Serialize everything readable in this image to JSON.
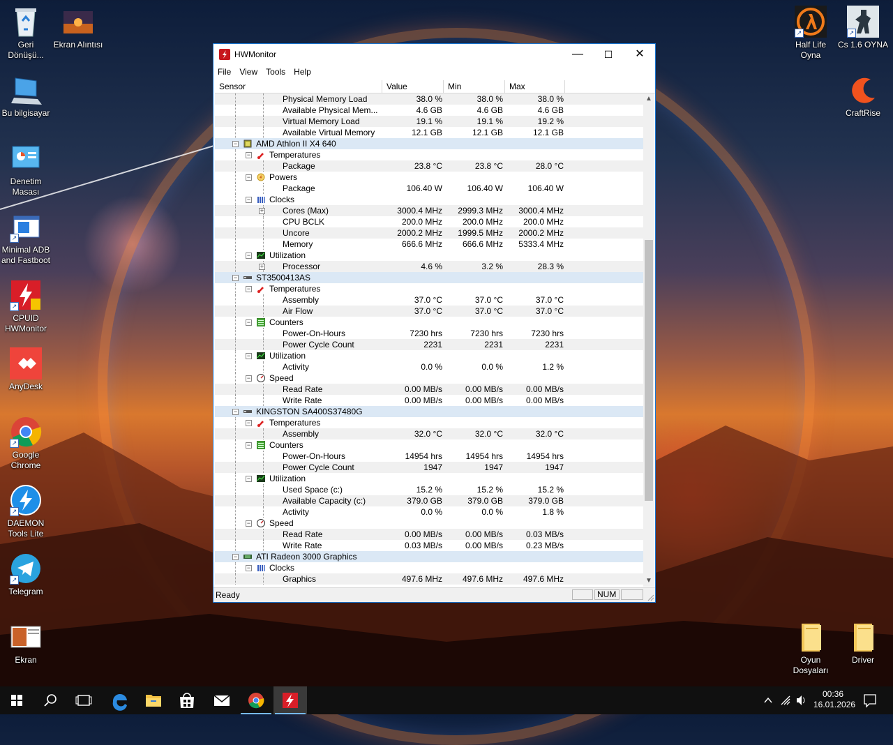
{
  "desktop_icons": [
    {
      "label": "Geri Dönüşü...",
      "icon": "recycle-bin-icon"
    },
    {
      "label": "Ekran Alıntısı",
      "icon": "image-file-icon"
    },
    {
      "label": "Bu bilgisayar",
      "icon": "computer-icon"
    },
    {
      "label": "Denetim Masası",
      "icon": "control-panel-icon"
    },
    {
      "label": "Minimal ADB and Fastboot",
      "icon": "adb-icon"
    },
    {
      "label": "CPUID HWMonitor",
      "icon": "hwmonitor-icon"
    },
    {
      "label": "AnyDesk",
      "icon": "anydesk-icon"
    },
    {
      "label": "Google Chrome",
      "icon": "chrome-icon"
    },
    {
      "label": "DAEMON Tools Lite",
      "icon": "daemon-tools-icon"
    },
    {
      "label": "Telegram",
      "icon": "telegram-icon"
    },
    {
      "label": "Ekran",
      "icon": "image-file-icon"
    },
    {
      "label": "Half Life Oyna",
      "icon": "half-life-icon"
    },
    {
      "label": "Cs 1.6 OYNA",
      "icon": "counter-strike-icon"
    },
    {
      "label": "CraftRise",
      "icon": "craftrise-icon"
    },
    {
      "label": "Oyun Dosyaları",
      "icon": "folder-icon"
    },
    {
      "label": "Driver",
      "icon": "folder-icon"
    }
  ],
  "window": {
    "title": "HWMonitor",
    "minimize": "—",
    "maximize": "☐",
    "close": "✕",
    "menu": [
      "File",
      "View",
      "Tools",
      "Help"
    ],
    "columns": [
      "Sensor",
      "Value",
      "Min",
      "Max"
    ],
    "rows": [
      {
        "label": "Physical Memory Load",
        "value": "38.0 %",
        "min": "38.0 %",
        "max": "38.0 %"
      },
      {
        "label": "Available Physical Mem...",
        "value": "4.6 GB",
        "min": "4.6 GB",
        "max": "4.6 GB"
      },
      {
        "label": "Virtual Memory Load",
        "value": "19.1 %",
        "min": "19.1 %",
        "max": "19.2 %"
      },
      {
        "label": "Available Virtual Memory",
        "value": "12.1 GB",
        "min": "12.1 GB",
        "max": "12.1 GB"
      },
      {
        "label": "AMD Athlon II X4 640"
      },
      {
        "label": "Temperatures"
      },
      {
        "label": "Package",
        "value": "23.8 °C",
        "min": "23.8 °C",
        "max": "28.0 °C"
      },
      {
        "label": "Powers"
      },
      {
        "label": "Package",
        "value": "106.40 W",
        "min": "106.40 W",
        "max": "106.40 W"
      },
      {
        "label": "Clocks"
      },
      {
        "label": "Cores (Max)",
        "value": "3000.4 MHz",
        "min": "2999.3 MHz",
        "max": "3000.4 MHz"
      },
      {
        "label": "CPU BCLK",
        "value": "200.0 MHz",
        "min": "200.0 MHz",
        "max": "200.0 MHz"
      },
      {
        "label": "Uncore",
        "value": "2000.2 MHz",
        "min": "1999.5 MHz",
        "max": "2000.2 MHz"
      },
      {
        "label": "Memory",
        "value": "666.6 MHz",
        "min": "666.6 MHz",
        "max": "5333.4 MHz"
      },
      {
        "label": "Utilization"
      },
      {
        "label": "Processor",
        "value": "4.6 %",
        "min": "3.2 %",
        "max": "28.3 %"
      },
      {
        "label": "ST3500413AS"
      },
      {
        "label": "Temperatures"
      },
      {
        "label": "Assembly",
        "value": "37.0 °C",
        "min": "37.0 °C",
        "max": "37.0 °C"
      },
      {
        "label": "Air Flow",
        "value": "37.0 °C",
        "min": "37.0 °C",
        "max": "37.0 °C"
      },
      {
        "label": "Counters"
      },
      {
        "label": "Power-On-Hours",
        "value": "7230 hrs",
        "min": "7230 hrs",
        "max": "7230 hrs"
      },
      {
        "label": "Power Cycle Count",
        "value": "2231",
        "min": "2231",
        "max": "2231"
      },
      {
        "label": "Utilization"
      },
      {
        "label": "Activity",
        "value": "0.0 %",
        "min": "0.0 %",
        "max": "1.2 %"
      },
      {
        "label": "Speed"
      },
      {
        "label": "Read Rate",
        "value": "0.00 MB/s",
        "min": "0.00 MB/s",
        "max": "0.00 MB/s"
      },
      {
        "label": "Write Rate",
        "value": "0.00 MB/s",
        "min": "0.00 MB/s",
        "max": "0.00 MB/s"
      },
      {
        "label": "KINGSTON SA400S37480G"
      },
      {
        "label": "Temperatures"
      },
      {
        "label": "Assembly",
        "value": "32.0 °C",
        "min": "32.0 °C",
        "max": "32.0 °C"
      },
      {
        "label": "Counters"
      },
      {
        "label": "Power-On-Hours",
        "value": "14954 hrs",
        "min": "14954 hrs",
        "max": "14954 hrs"
      },
      {
        "label": "Power Cycle Count",
        "value": "1947",
        "min": "1947",
        "max": "1947"
      },
      {
        "label": "Utilization"
      },
      {
        "label": "Used Space (c:)",
        "value": "15.2 %",
        "min": "15.2 %",
        "max": "15.2 %"
      },
      {
        "label": "Available Capacity (c:)",
        "value": "379.0 GB",
        "min": "379.0 GB",
        "max": "379.0 GB"
      },
      {
        "label": "Activity",
        "value": "0.0 %",
        "min": "0.0 %",
        "max": "1.8 %"
      },
      {
        "label": "Speed"
      },
      {
        "label": "Read Rate",
        "value": "0.00 MB/s",
        "min": "0.00 MB/s",
        "max": "0.03 MB/s"
      },
      {
        "label": "Write Rate",
        "value": "0.03 MB/s",
        "min": "0.00 MB/s",
        "max": "0.23 MB/s"
      },
      {
        "label": "ATI Radeon 3000 Graphics"
      },
      {
        "label": "Clocks"
      },
      {
        "label": "Graphics",
        "value": "497.6 MHz",
        "min": "497.6 MHz",
        "max": "497.6 MHz"
      }
    ],
    "status": {
      "text": "Ready",
      "num": "NUM"
    }
  },
  "taskbar": {
    "items": [
      "start-icon",
      "search-icon",
      "task-view-icon",
      "edge-icon",
      "file-explorer-icon",
      "store-icon",
      "mail-icon",
      "chrome-icon",
      "hwmonitor-icon"
    ],
    "time": "00:36",
    "date": "16.01.2026"
  }
}
